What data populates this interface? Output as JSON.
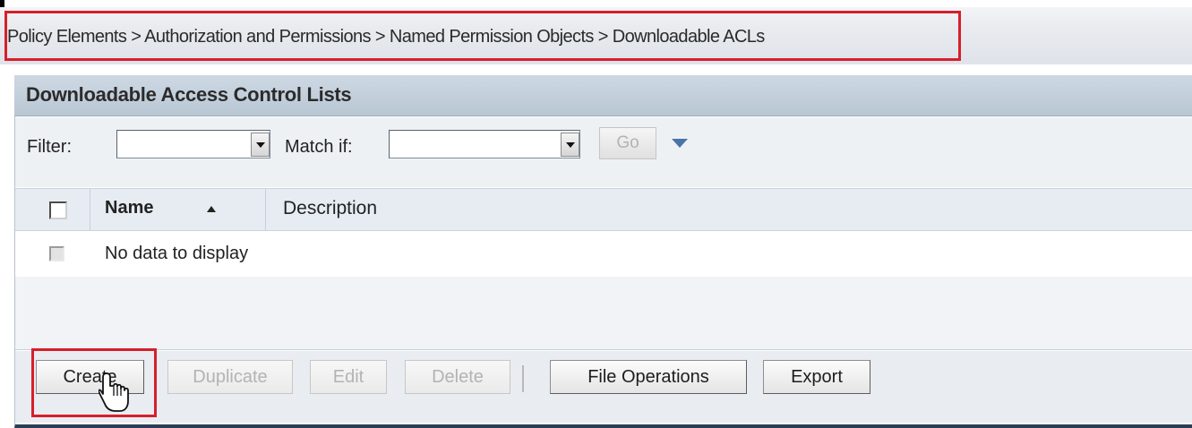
{
  "breadcrumb": {
    "text": "Policy Elements > Authorization and Permissions  > Named Permission Objects > Downloadable ACLs"
  },
  "panel": {
    "title": "Downloadable Access Control Lists"
  },
  "filter": {
    "filter_label": "Filter:",
    "filter_value": "",
    "match_label": "Match if:",
    "match_value": "",
    "go_label": "Go"
  },
  "table": {
    "columns": [
      {
        "label": "Name",
        "sorted": "ascending"
      },
      {
        "label": "Description"
      }
    ],
    "empty_message": "No data to display"
  },
  "toolbar": {
    "create_label": "Create",
    "duplicate_label": "Duplicate",
    "edit_label": "Edit",
    "delete_label": "Delete",
    "file_operations_label": "File Operations",
    "export_label": "Export"
  },
  "colors": {
    "highlight_outline": "#d71f2b",
    "panel_title_bg": "#c3d0dc",
    "disabled_text": "#b3b3b3"
  },
  "icons": {
    "dropdown": "chevron-down-icon",
    "sort": "sort-ascending-icon",
    "advanced_filter": "triangle-down-icon",
    "pointer": "hand-pointer-icon"
  }
}
